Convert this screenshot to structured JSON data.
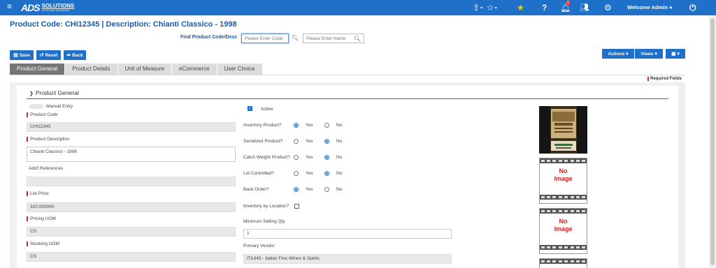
{
  "topbar": {
    "logo_main": "ADS",
    "logo_sub": "SOLUTIONS",
    "logo_tag": "VALUE ERP SOFTWARE",
    "notifications_count": "6",
    "welcome": "Welcome Admin"
  },
  "header": {
    "title": "Product Code:  CHI12345 | Description: Chianti Classico - 1998",
    "find_label": "Find Product Code/Desc",
    "code_placeholder": "Please Enter Code",
    "name_placeholder": "Please Enter Name"
  },
  "toolbar": {
    "save": "Save",
    "reset": "Reset",
    "back": "Back",
    "actions": "Actions",
    "views": "Views"
  },
  "tabs": [
    "Product General",
    "Product Details",
    "Unit of Measure",
    "eCommerce",
    "User Choice"
  ],
  "required_fields": "Required Fields",
  "section": {
    "title": "Product General",
    "manual_entry": "Manual Entry"
  },
  "left_fields": {
    "product_code_label": "Product Code",
    "product_code": "CHI12345",
    "product_description_label": "Product Description",
    "product_description": "Chianti Classico - 1998",
    "addl_references_label": "Add'l References",
    "addl_references": "",
    "list_price_label": "List Price",
    "list_price": "320.000000",
    "pricing_uom_label": "Pricing UOM",
    "pricing_uom": "CS",
    "stocking_uom_label": "Stocking UOM",
    "stocking_uom": "CS"
  },
  "middle_fields": {
    "active_label": "Active",
    "inventory_product": "Inventory Product?",
    "serialized_product": "Serialized Product?",
    "catch_weight": "Catch Weight Product?",
    "lot_controlled": "Lot Controlled?",
    "back_order": "Back Order?",
    "yes": "Yes",
    "no": "No",
    "inventory_by_location": "Inventory by Location?",
    "min_selling_qty_label": "Minimum Selling Qty",
    "min_selling_qty": "1",
    "primary_vendor_label": "Primary Vendor",
    "primary_vendor": "ITA345 - Italian Fine Wines & Spirits"
  },
  "images": {
    "no_image_line1": "No",
    "no_image_line2": "Image"
  },
  "colors": {
    "brand_blue": "#1e70c9",
    "required_red": "#b03030",
    "star_yellow": "#f5d000"
  }
}
